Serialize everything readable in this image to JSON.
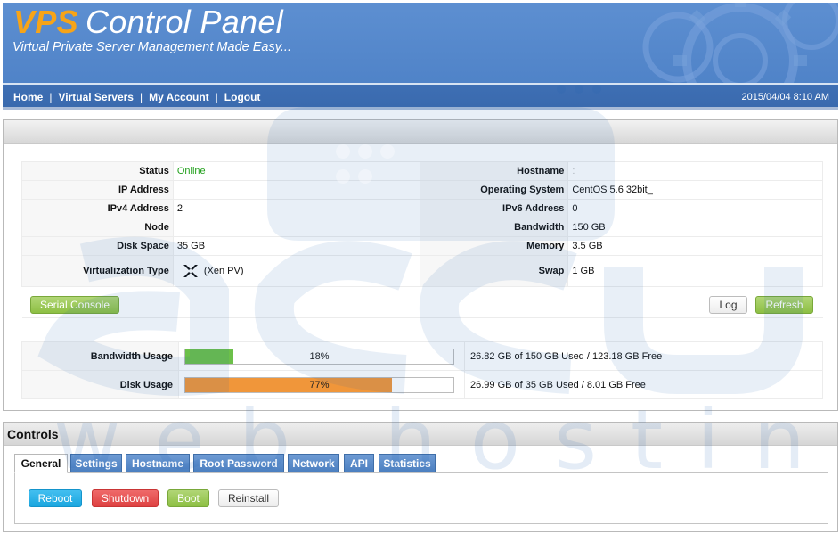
{
  "header": {
    "brand_vps": "VPS",
    "brand_rest": "Control Panel",
    "tagline": "Virtual Private Server Management Made Easy...",
    "nav": [
      "Home",
      "Virtual Servers",
      "My Account",
      "Logout"
    ],
    "separator": "|",
    "datetime": "2015/04/04 8:10 AM"
  },
  "info": {
    "status_label": "Status",
    "status_value": "Online",
    "hostname_label": "Hostname",
    "hostname_value": ":",
    "ip_label": "IP Address",
    "ip_value": "",
    "os_label": "Operating System",
    "os_value": "CentOS 5.6 32bit_",
    "ipv4_label": "IPv4 Address",
    "ipv4_value": "2",
    "ipv6_label": "IPv6 Address",
    "ipv6_value": "0",
    "node_label": "Node",
    "node_value": "",
    "bandwidth_label": "Bandwidth",
    "bandwidth_value": "150 GB",
    "disk_label": "Disk Space",
    "disk_value": "35 GB",
    "memory_label": "Memory",
    "memory_value": "3.5 GB",
    "virt_label": "Virtualization Type",
    "virt_value": "(Xen PV)",
    "virt_icon": "xen-logo-icon",
    "swap_label": "Swap",
    "swap_value": "1 GB"
  },
  "buttons": {
    "serial_console": "Serial Console",
    "log": "Log",
    "refresh": "Refresh"
  },
  "usage": {
    "bandwidth_label": "Bandwidth Usage",
    "bandwidth_percent": 18,
    "bandwidth_percent_text": "18%",
    "bandwidth_detail": "26.82 GB of 150 GB Used / 123.18 GB Free",
    "bandwidth_color": "#6cc04a",
    "disk_label": "Disk Usage",
    "disk_percent": 77,
    "disk_percent_text": "77%",
    "disk_detail": "26.99 GB of 35 GB Used / 8.01 GB Free",
    "disk_color": "#f0963a"
  },
  "controls": {
    "title": "Controls",
    "tabs": [
      "General",
      "Settings",
      "Hostname",
      "Root Password",
      "Network",
      "API",
      "Statistics"
    ],
    "active_tab": "General",
    "actions": {
      "reboot": "Reboot",
      "shutdown": "Shutdown",
      "boot": "Boot",
      "reinstall": "Reinstall"
    }
  },
  "watermark": {
    "text": "web hosting"
  }
}
